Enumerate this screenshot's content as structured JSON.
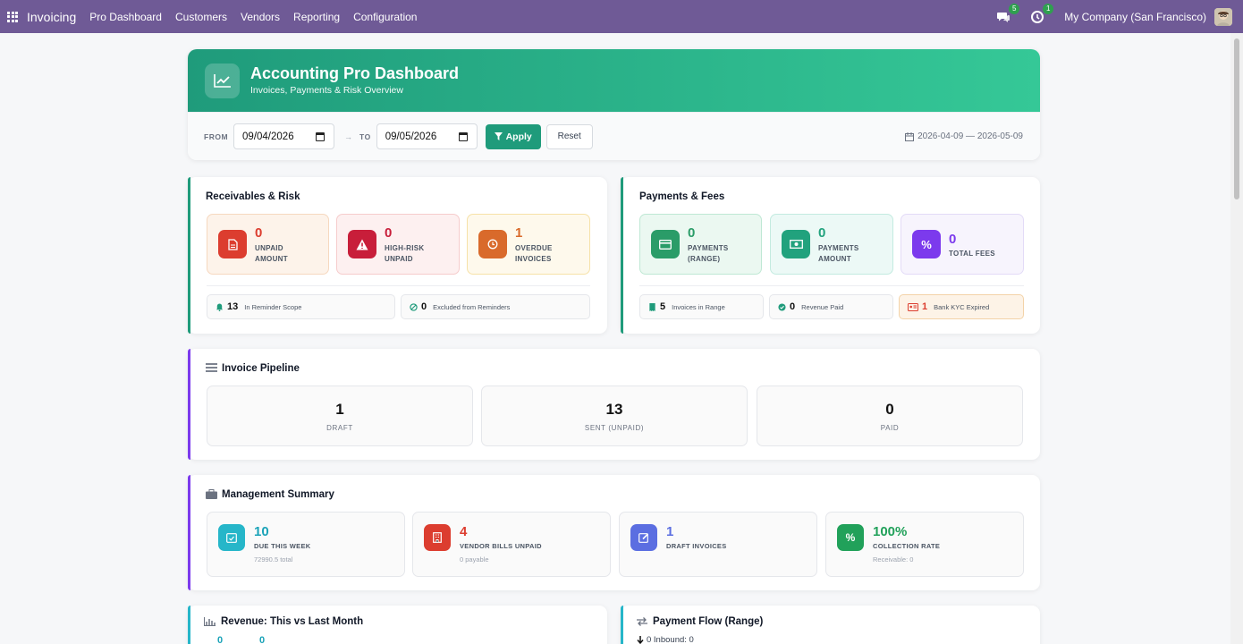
{
  "topbar": {
    "app_name": "Invoicing",
    "menu": [
      "Pro Dashboard",
      "Customers",
      "Vendors",
      "Reporting",
      "Configuration"
    ],
    "messages_count": "5",
    "activities_count": "1",
    "company": "My Company (San Francisco)"
  },
  "header": {
    "title": "Accounting Pro Dashboard",
    "subtitle": "Invoices, Payments & Risk Overview",
    "from_label": "FROM",
    "from_value": "09/04/2026",
    "arrow": "→",
    "to_label": "TO",
    "to_value": "09/05/2026",
    "apply_label": "Apply",
    "reset_label": "Reset",
    "range_text": "2026-04-09 — 2026-05-09"
  },
  "receivables": {
    "title": "Receivables & Risk",
    "tiles": [
      {
        "value": "0",
        "label1": "UNPAID",
        "label2": "AMOUNT"
      },
      {
        "value": "0",
        "label1": "HIGH-RISK",
        "label2": "UNPAID"
      },
      {
        "value": "1",
        "label1": "OVERDUE",
        "label2": "INVOICES"
      }
    ],
    "chips": [
      {
        "value": "13",
        "label": "In Reminder Scope"
      },
      {
        "value": "0",
        "label": "Excluded from Reminders"
      }
    ]
  },
  "payments": {
    "title": "Payments & Fees",
    "tiles": [
      {
        "value": "0",
        "label1": "PAYMENTS",
        "label2": "(RANGE)"
      },
      {
        "value": "0",
        "label1": "PAYMENTS",
        "label2": "AMOUNT"
      },
      {
        "value": "0",
        "label1": "TOTAL FEES",
        "label2": ""
      }
    ],
    "chips": [
      {
        "value": "5",
        "label": "Invoices in Range"
      },
      {
        "value": "0",
        "label": "Revenue Paid"
      },
      {
        "value": "1",
        "label": "Bank KYC Expired"
      }
    ]
  },
  "pipeline": {
    "title": "Invoice Pipeline",
    "items": [
      {
        "value": "1",
        "label": "DRAFT"
      },
      {
        "value": "13",
        "label": "SENT (UNPAID)"
      },
      {
        "value": "0",
        "label": "PAID"
      }
    ]
  },
  "management": {
    "title": "Management Summary",
    "items": [
      {
        "value": "10",
        "label": "DUE THIS WEEK",
        "sub": "72990.5 total"
      },
      {
        "value": "4",
        "label": "VENDOR BILLS UNPAID",
        "sub": "0 payable"
      },
      {
        "value": "1",
        "label": "DRAFT INVOICES",
        "sub": ""
      },
      {
        "value": "100%",
        "label": "COLLECTION RATE",
        "sub": "Receivable: 0"
      }
    ]
  },
  "revenue": {
    "title": "Revenue: This vs Last Month",
    "values": [
      "0",
      "0"
    ]
  },
  "payment_flow": {
    "title": "Payment Flow (Range)",
    "inbound_label": "0 Inbound: 0"
  },
  "colors": {
    "topbar": "#6f5a96",
    "accent_green": "#1f9b7b",
    "accent_purple": "#7c3aed",
    "red": "#dc3d2f",
    "crimson": "#c81e3a",
    "orange": "#d96a2b",
    "teal": "#26b6c9",
    "indigo": "#5b6ee1"
  }
}
